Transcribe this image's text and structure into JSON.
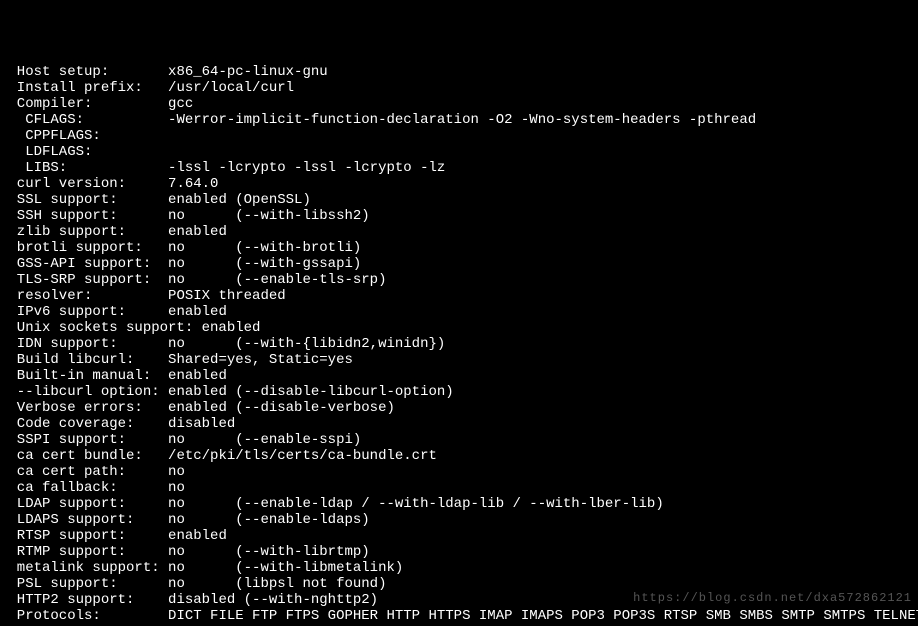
{
  "lines": [
    {
      "label": "  Host setup:     ",
      "value": "  x86_64-pc-linux-gnu"
    },
    {
      "label": "  Install prefix: ",
      "value": "  /usr/local/curl"
    },
    {
      "label": "  Compiler:       ",
      "value": "  gcc"
    },
    {
      "label": "   CFLAGS:        ",
      "value": "  -Werror-implicit-function-declaration -O2 -Wno-system-headers -pthread"
    },
    {
      "label": "   CPPFLAGS:      ",
      "value": "  "
    },
    {
      "label": "   LDFLAGS:       ",
      "value": "  "
    },
    {
      "label": "   LIBS:          ",
      "value": "  -lssl -lcrypto -lssl -lcrypto -lz"
    },
    {
      "label": "",
      "value": ""
    },
    {
      "label": "  curl version:   ",
      "value": "  7.64.0"
    },
    {
      "label": "  SSL support:    ",
      "value": "  enabled (OpenSSL)"
    },
    {
      "label": "  SSH support:    ",
      "value": "  no      (--with-libssh2)"
    },
    {
      "label": "  zlib support:   ",
      "value": "  enabled"
    },
    {
      "label": "  brotli support: ",
      "value": "  no      (--with-brotli)"
    },
    {
      "label": "  GSS-API support:",
      "value": "  no      (--with-gssapi)"
    },
    {
      "label": "  TLS-SRP support:",
      "value": "  no      (--enable-tls-srp)"
    },
    {
      "label": "  resolver:       ",
      "value": "  POSIX threaded"
    },
    {
      "label": "  IPv6 support:   ",
      "value": "  enabled"
    },
    {
      "label": "  Unix sockets support: enabled",
      "value": ""
    },
    {
      "label": "  IDN support:    ",
      "value": "  no      (--with-{libidn2,winidn})"
    },
    {
      "label": "  Build libcurl:  ",
      "value": "  Shared=yes, Static=yes"
    },
    {
      "label": "  Built-in manual:",
      "value": "  enabled"
    },
    {
      "label": "  --libcurl option:",
      "value": " enabled (--disable-libcurl-option)"
    },
    {
      "label": "  Verbose errors: ",
      "value": "  enabled (--disable-verbose)"
    },
    {
      "label": "  Code coverage:  ",
      "value": "  disabled"
    },
    {
      "label": "  SSPI support:   ",
      "value": "  no      (--enable-sspi)"
    },
    {
      "label": "  ca cert bundle: ",
      "value": "  /etc/pki/tls/certs/ca-bundle.crt"
    },
    {
      "label": "  ca cert path:   ",
      "value": "  no"
    },
    {
      "label": "  ca fallback:    ",
      "value": "  no"
    },
    {
      "label": "  LDAP support:   ",
      "value": "  no      (--enable-ldap / --with-ldap-lib / --with-lber-lib)"
    },
    {
      "label": "  LDAPS support:  ",
      "value": "  no      (--enable-ldaps)"
    },
    {
      "label": "  RTSP support:   ",
      "value": "  enabled"
    },
    {
      "label": "  RTMP support:   ",
      "value": "  no      (--with-librtmp)"
    },
    {
      "label": "  metalink support:",
      "value": " no      (--with-libmetalink)"
    },
    {
      "label": "  PSL support:    ",
      "value": "  no      (libpsl not found)"
    },
    {
      "label": "  HTTP2 support:  ",
      "value": "  disabled (--with-nghttp2)"
    },
    {
      "label": "  Protocols:      ",
      "value": "  DICT FILE FTP FTPS GOPHER HTTP HTTPS IMAP IMAPS POP3 POP3S RTSP SMB SMBS SMTP SMTPS TELNET TFTP"
    }
  ],
  "watermark": "https://blog.csdn.net/dxa572862121"
}
